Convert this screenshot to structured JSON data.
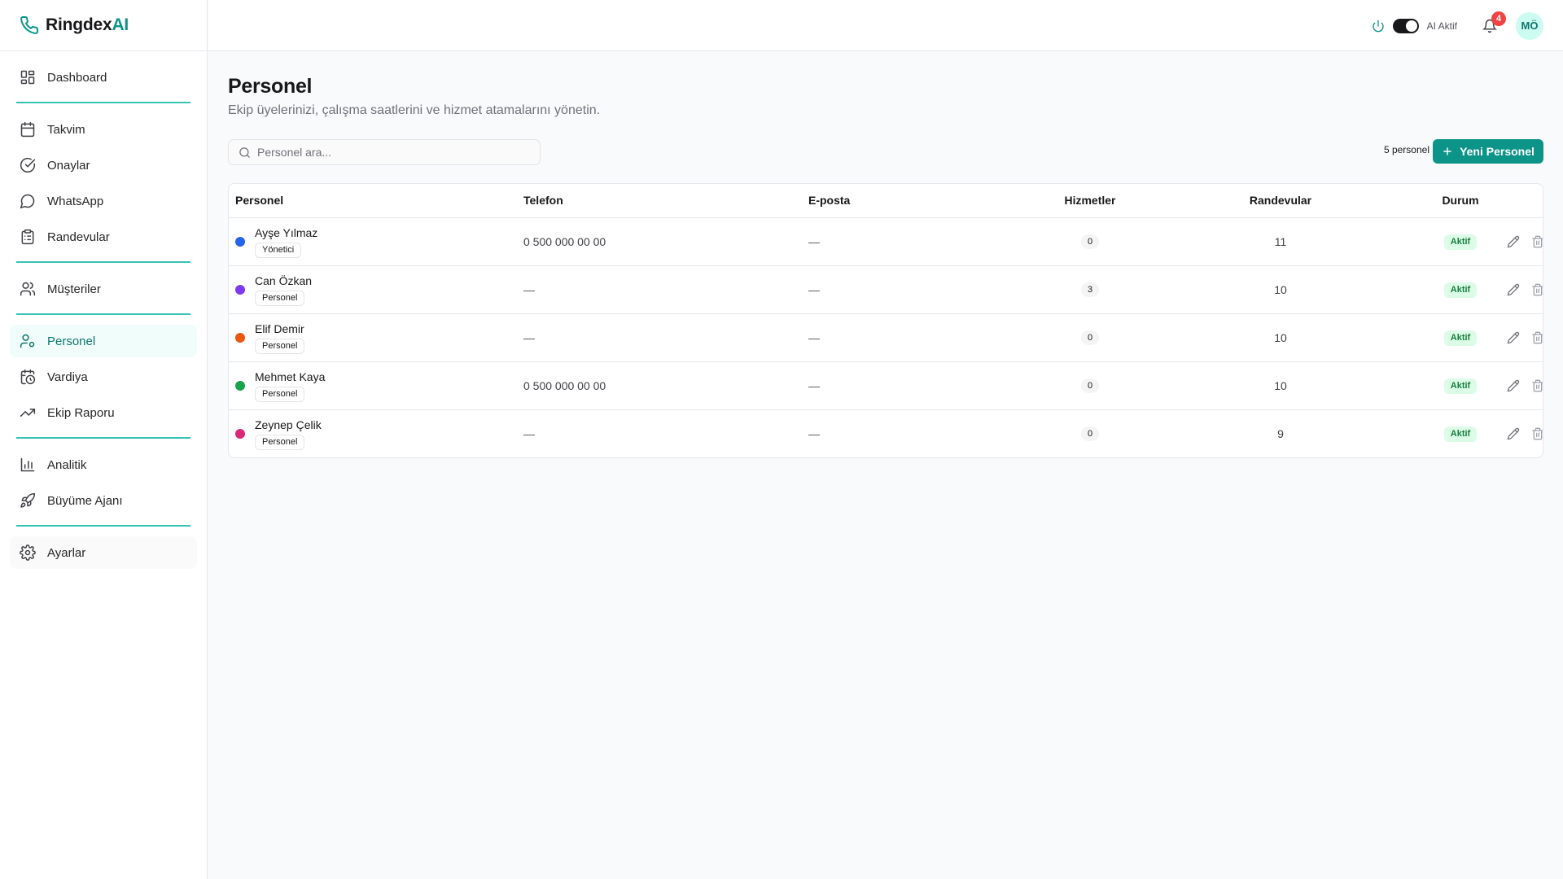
{
  "brand": {
    "name": "Ringdex",
    "suffix": "AI"
  },
  "nav": {
    "dashboard": "Dashboard",
    "takvim": "Takvim",
    "onaylar": "Onaylar",
    "whatsapp": "WhatsApp",
    "randevular": "Randevular",
    "musteriler": "Müşteriler",
    "personel": "Personel",
    "vardiya": "Vardiya",
    "ekip_raporu": "Ekip Raporu",
    "analitik": "Analitik",
    "buyume_ajani": "Büyüme Ajanı",
    "ayarlar": "Ayarlar"
  },
  "topbar": {
    "ai_label": "AI Aktif",
    "notifications": "4",
    "avatar": "MÖ"
  },
  "page": {
    "title": "Personel",
    "subtitle": "Ekip üyelerinizi, çalışma saatlerini ve hizmet atamalarını yönetin."
  },
  "search": {
    "placeholder": "Personel ara..."
  },
  "count_label": "5 personel",
  "new_button": "Yeni Personel",
  "table": {
    "headers": {
      "personel": "Personel",
      "telefon": "Telefon",
      "eposta": "E-posta",
      "hizmetler": "Hizmetler",
      "randevular": "Randevular",
      "durum": "Durum"
    },
    "rows": [
      {
        "name": "Ayşe Yılmaz",
        "role": "Yönetici",
        "color": "#2563eb",
        "phone": "0 500 000 00 00",
        "email": "—",
        "services": "0",
        "appointments": "11",
        "status": "Aktif"
      },
      {
        "name": "Can Özkan",
        "role": "Personel",
        "color": "#7c3aed",
        "phone": "—",
        "email": "—",
        "services": "3",
        "appointments": "10",
        "status": "Aktif"
      },
      {
        "name": "Elif Demir",
        "role": "Personel",
        "color": "#ea580c",
        "phone": "—",
        "email": "—",
        "services": "0",
        "appointments": "10",
        "status": "Aktif"
      },
      {
        "name": "Mehmet Kaya",
        "role": "Personel",
        "color": "#16a34a",
        "phone": "0 500 000 00 00",
        "email": "—",
        "services": "0",
        "appointments": "10",
        "status": "Aktif"
      },
      {
        "name": "Zeynep Çelik",
        "role": "Personel",
        "color": "#db2777",
        "phone": "—",
        "email": "—",
        "services": "0",
        "appointments": "9",
        "status": "Aktif"
      }
    ]
  }
}
